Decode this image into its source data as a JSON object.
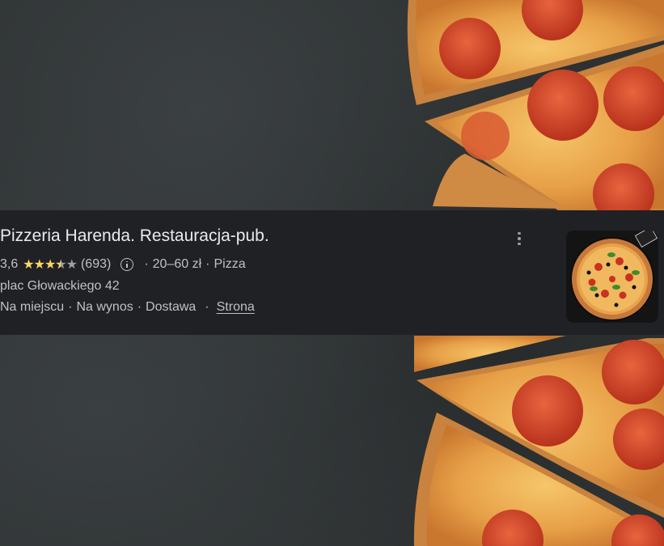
{
  "listing": {
    "title": "Pizzeria Harenda. Restauracja-pub.",
    "rating": "3,6",
    "rating_value": 3.6,
    "review_count": "(693)",
    "price_range": "20–60 zł",
    "category": "Pizza",
    "address": "plac Głowackiego 42",
    "services": [
      "Na miejscu",
      "Na wynos",
      "Dostawa"
    ],
    "website_label": "Strona",
    "separator": "·"
  },
  "icons": {
    "info": "info-icon",
    "more": "more-vert-icon",
    "star": "star-icon"
  },
  "colors": {
    "card_bg": "#202124",
    "title": "#e8eaed",
    "text": "#bdc1c6",
    "star_filled": "#fdd663",
    "star_empty": "#9aa0a6"
  }
}
